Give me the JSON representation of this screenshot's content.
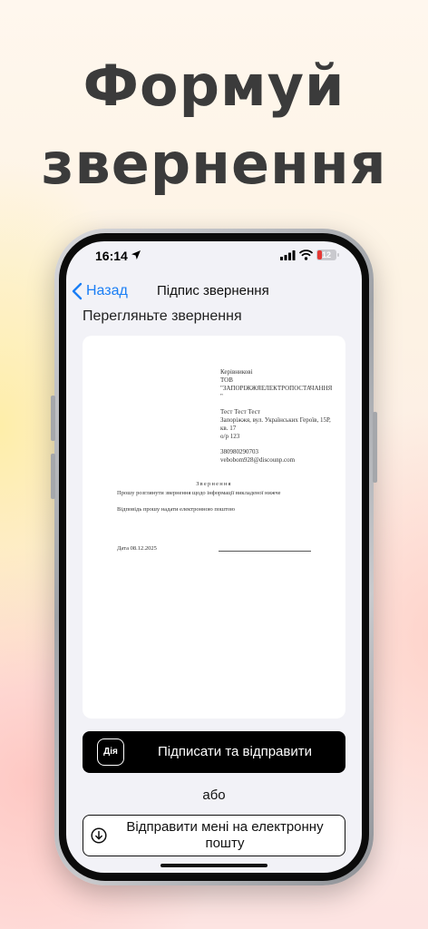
{
  "hero": {
    "line1": "Формуй",
    "line2": "звернення"
  },
  "status_bar": {
    "time": "16:14",
    "battery": "12"
  },
  "nav": {
    "back_label": "Назад",
    "title": "Підпис звернення"
  },
  "section_title": "Перегляньте звернення",
  "document": {
    "recipient": {
      "line1": "Керівникові",
      "line2": "ТОВ",
      "line3": "\"ЗАПОРІЖЖЯЕЛЕКТРОПОСТАЧАННЯ\"",
      "name": "Тест Тест Тест",
      "address": "Запоріжжя, вул. Українських Героїв, 15Р, кв. 17",
      "account": "о/р 123",
      "phone": "380980290703",
      "email": "vebobom928@discounp.com"
    },
    "heading": "Звернення",
    "body_line1": "Прошу розглянути звернення щодо інформації викладеної нижче",
    "body_line2": "Відповідь прошу надати електронною поштою",
    "date": "Дата 08.12.2025"
  },
  "primary_button": {
    "icon_text": "Дія",
    "label": "Підписати та відправити"
  },
  "or_label": "або",
  "secondary_button": {
    "label": "Відправити мені на електронну пошту"
  },
  "colors": {
    "accent": "#1a7ef5",
    "primary_button": "#000000",
    "battery_low": "#e53935"
  },
  "icons": [
    "location-arrow-icon",
    "signal-icon",
    "wifi-icon",
    "battery-icon",
    "chevron-left-icon",
    "diia-icon",
    "download-icon"
  ]
}
